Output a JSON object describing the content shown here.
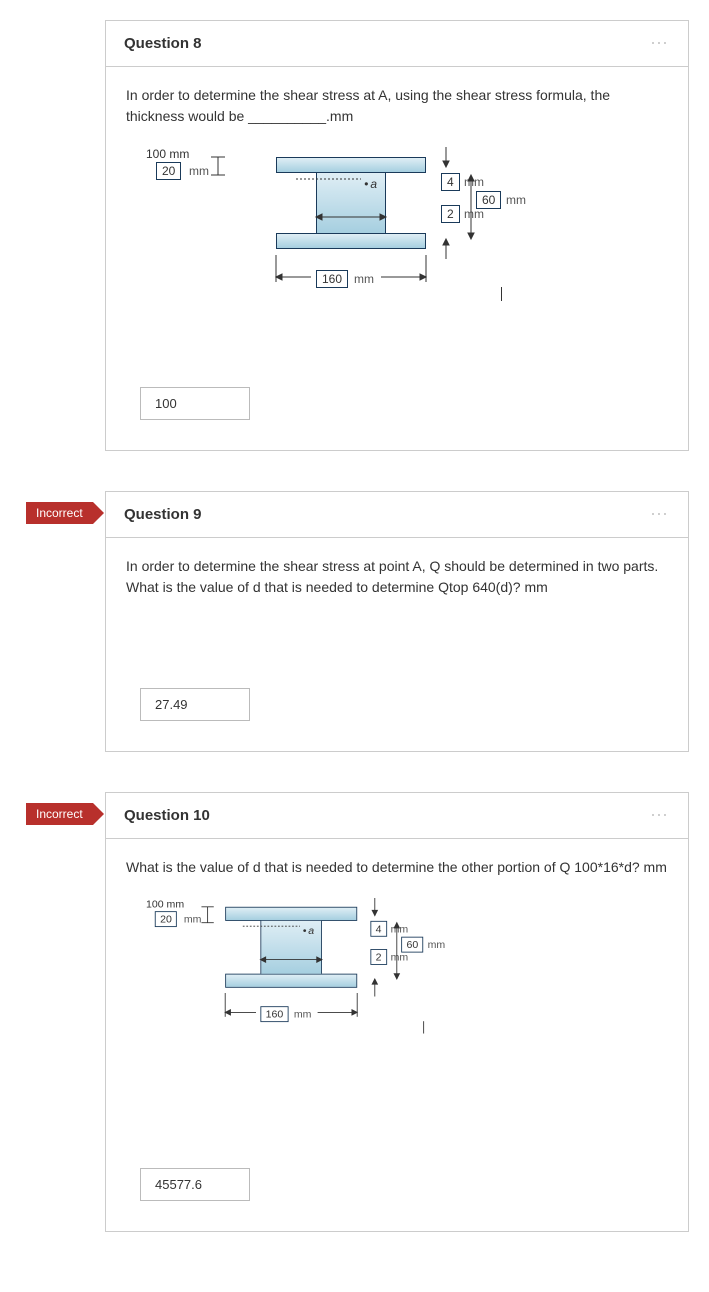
{
  "q8": {
    "title": "Question 8",
    "prompt": "In order to determine the shear stress at A, using the shear stress formula, the thickness would be __________.mm",
    "answer": "100",
    "diagram": {
      "d20": "20",
      "u20": "mm",
      "d4": "4",
      "u4": "mm",
      "d60": "60",
      "u60": "mm",
      "d2": "2",
      "u2": "mm",
      "d100": "100 mm",
      "d160": "160",
      "u160": "mm",
      "pointA": "a"
    }
  },
  "q9": {
    "flag": "Incorrect",
    "title": "Question 9",
    "prompt": "In order to determine the shear stress at point A,  Q should be determined in two parts. What is the value of d that is needed to determine Qtop 640(d)? mm",
    "answer": "27.49"
  },
  "q10": {
    "flag": "Incorrect",
    "title": "Question 10",
    "prompt": "What is the value of d that is needed to determine the other portion of Q 100*16*d? mm",
    "answer": "45577.6",
    "diagram": {
      "d20": "20",
      "u20": "mm",
      "d4": "4",
      "u4": "mm",
      "d60": "60",
      "u60": "mm",
      "d2": "2",
      "u2": "mm",
      "d100": "100 mm",
      "d160": "160",
      "u160": "mm",
      "pointA": "a"
    }
  }
}
